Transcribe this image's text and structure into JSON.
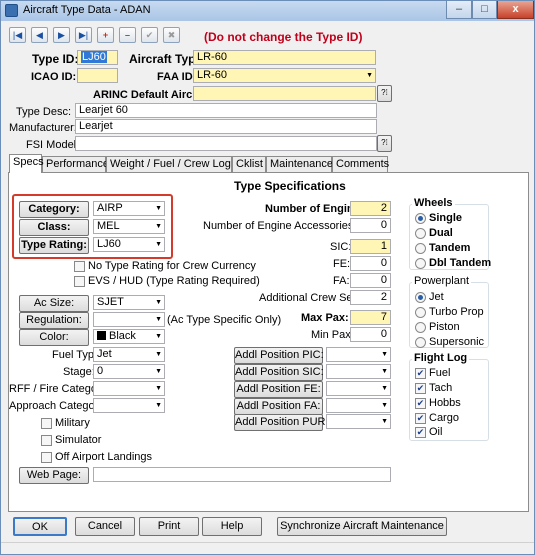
{
  "window": {
    "title": "Aircraft Type Data - ADAN",
    "min": "–",
    "max": "□",
    "close": "x"
  },
  "toolbar": {
    "first": "|◀",
    "prev": "◀",
    "next": "▶",
    "last": "▶|",
    "add": "+",
    "delete": "–",
    "save": "✔",
    "cancel": "✖",
    "warning": "(Do not change the Type ID)",
    "warning_color": "#c0001a"
  },
  "header": {
    "type_id_label": "Type ID:",
    "type_id_value": "LJ60",
    "aircraft_type_label": "Aircraft Type:",
    "aircraft_type_value": "LR-60",
    "icao_id_label": "ICAO ID:",
    "icao_id_value": "",
    "faa_id_label": "FAA ID:",
    "faa_id_value": "LR-60",
    "arinc_label": "ARINC Default Aircraft:",
    "arinc_value": "",
    "type_desc_label": "Type Desc:",
    "type_desc_value": "Learjet 60",
    "manufacturer_label": "Manufacturer:",
    "manufacturer_value": "Learjet",
    "fsi_model_label": "FSI Model:",
    "fsi_model_value": ""
  },
  "tabs": [
    "Specs",
    "Performance",
    "Weight / Fuel / Crew Log",
    "Cklist",
    "Maintenance",
    "Comments"
  ],
  "specs": {
    "heading": "Type Specifications",
    "category_label": "Category:",
    "category_value": "AIRP",
    "class_label": "Class:",
    "class_value": "MEL",
    "type_rating_label": "Type Rating:",
    "type_rating_value": "LJ60",
    "no_type_rating": "No Type Rating for Crew Currency",
    "evs_hud": "EVS / HUD (Type Rating Required)",
    "ac_size_label": "Ac Size:",
    "ac_size_value": "SJET",
    "regulation_label": "Regulation:",
    "regulation_value": "",
    "regulation_note": "(Ac Type Specific Only)",
    "color_label": "Color:",
    "color_value": "Black",
    "fuel_type_label": "Fuel Type:",
    "fuel_type_value": "Jet",
    "stage_label": "Stage:",
    "stage_value": "0",
    "rff_label": "RFF / Fire Category:",
    "rff_value": "",
    "approach_label": "Approach Category:",
    "approach_value": "",
    "military": "Military",
    "simulator": "Simulator",
    "off_airport": "Off Airport Landings",
    "web_page_label": "Web Page:",
    "web_page_value": "",
    "num_engines_label": "Number of Engines:",
    "num_engines_value": "2",
    "num_accessories_label": "Number of Engine Accessories:",
    "num_accessories_value": "0",
    "sic_label": "SIC:",
    "sic_value": "1",
    "fe_label": "FE:",
    "fe_value": "0",
    "fa_label": "FA:",
    "fa_value": "0",
    "addl_crew_label": "Additional Crew Seats:",
    "addl_crew_value": "2",
    "max_pax_label": "Max Pax:",
    "max_pax_value": "7",
    "min_pax_label": "Min Pax:",
    "min_pax_value": "0",
    "addl_pic": "Addl Position PIC:",
    "addl_sic": "Addl Position SIC:",
    "addl_fe": "Addl Position FE:",
    "addl_fa": "Addl Position FA:",
    "addl_pur": "Addl Position PUR:",
    "wheels_title": "Wheels",
    "wheels": [
      "Single",
      "Dual",
      "Tandem",
      "Dbl Tandem"
    ],
    "powerplant_title": "Powerplant",
    "powerplant": [
      "Jet",
      "Turbo Prop",
      "Piston",
      "Supersonic"
    ],
    "flightlog_title": "Flight Log",
    "flightlog": [
      "Fuel",
      "Tach",
      "Hobbs",
      "Cargo",
      "Oil"
    ]
  },
  "buttons": {
    "ok": "OK",
    "cancel": "Cancel",
    "print": "Print",
    "help": "Help",
    "sync": "Synchronize Aircraft Maintenance"
  }
}
